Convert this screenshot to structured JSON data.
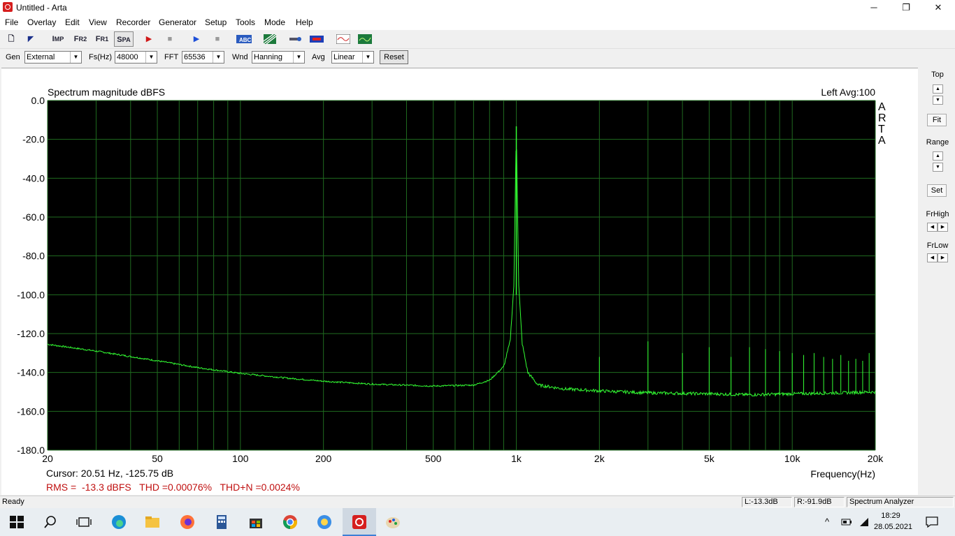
{
  "window": {
    "title": "Untitled - Arta"
  },
  "menu": [
    "File",
    "Overlay",
    "Edit",
    "View",
    "Recorder",
    "Generator",
    "Setup",
    "Tools",
    "Mode",
    "Help"
  ],
  "toolbar": {
    "buttons": [
      {
        "name": "open-icon",
        "glyph": "▯"
      },
      {
        "name": "pointer-icon",
        "glyph": "◤"
      },
      {
        "name": "imp-button",
        "glyph": "IMP"
      },
      {
        "name": "fr2-button",
        "glyph": "FR2"
      },
      {
        "name": "fr1-button",
        "glyph": "FR1"
      },
      {
        "name": "spa-button",
        "glyph": "SPA"
      },
      {
        "name": "record-play-icon",
        "glyph": "▶"
      },
      {
        "name": "record-stop-icon",
        "glyph": "■"
      },
      {
        "name": "play-icon",
        "glyph": "▶"
      },
      {
        "name": "stop-icon",
        "glyph": "■"
      }
    ]
  },
  "params": {
    "gen_label": "Gen",
    "gen_value": "External",
    "fs_label": "Fs(Hz)",
    "fs_value": "48000",
    "fft_label": "FFT",
    "fft_value": "65536",
    "wnd_label": "Wnd",
    "wnd_value": "Hanning",
    "avg_label": "Avg",
    "avg_value": "Linear",
    "reset_label": "Reset"
  },
  "side": {
    "top_label": "Top",
    "fit_label": "Fit",
    "range_label": "Range",
    "set_label": "Set",
    "frhigh_label": "FrHigh",
    "frlow_label": "FrLow"
  },
  "chart_data": {
    "type": "line",
    "title": "Spectrum magnitude dBFS",
    "channel_info": "Left  Avg:100",
    "watermark": "ARTA",
    "xlabel": "Frequency(Hz)",
    "xscale": "log",
    "xlim": [
      20,
      20000
    ],
    "ylim": [
      -180,
      0
    ],
    "x_tick_labels": [
      {
        "v": 20,
        "t": "20"
      },
      {
        "v": 50,
        "t": "50"
      },
      {
        "v": 100,
        "t": "100"
      },
      {
        "v": 200,
        "t": "200"
      },
      {
        "v": 500,
        "t": "500"
      },
      {
        "v": 1000,
        "t": "1k"
      },
      {
        "v": 2000,
        "t": "2k"
      },
      {
        "v": 5000,
        "t": "5k"
      },
      {
        "v": 10000,
        "t": "10k"
      },
      {
        "v": 20000,
        "t": "20k"
      }
    ],
    "y_tick_labels": [
      "0.0",
      "-20.0",
      "-40.0",
      "-60.0",
      "-80.0",
      "-100.0",
      "-120.0",
      "-140.0",
      "-160.0",
      "-180.0"
    ],
    "series": [
      {
        "color": "#33ff33",
        "x": [
          20,
          30,
          50,
          70,
          100,
          150,
          200,
          300,
          500,
          700,
          800,
          900,
          950,
          980,
          1000,
          1020,
          1050,
          1100,
          1200,
          1500,
          2000,
          3000,
          5000,
          7000,
          10000,
          15000,
          20000
        ],
        "y": [
          -125.5,
          -129,
          -134,
          -137.5,
          -140.5,
          -143,
          -144.5,
          -146,
          -147,
          -146.5,
          -144,
          -137,
          -124,
          -95,
          -13.3,
          -95,
          -125,
          -140,
          -146.5,
          -148.5,
          -149.5,
          -150.5,
          -151,
          -151.5,
          -151,
          -150.5,
          -150
        ]
      }
    ],
    "harmonics": [
      {
        "f": 2000,
        "db": -132
      },
      {
        "f": 3000,
        "db": -124
      },
      {
        "f": 4000,
        "db": -130
      },
      {
        "f": 5000,
        "db": -127
      },
      {
        "f": 6000,
        "db": -132
      },
      {
        "f": 7000,
        "db": -127
      },
      {
        "f": 8000,
        "db": -128
      },
      {
        "f": 9000,
        "db": -129
      },
      {
        "f": 10000,
        "db": -130
      },
      {
        "f": 11000,
        "db": -131
      },
      {
        "f": 12000,
        "db": -130
      },
      {
        "f": 13000,
        "db": -132
      },
      {
        "f": 14000,
        "db": -133
      },
      {
        "f": 15000,
        "db": -131
      },
      {
        "f": 16000,
        "db": -134
      },
      {
        "f": 17000,
        "db": -133
      },
      {
        "f": 18000,
        "db": -134
      },
      {
        "f": 19000,
        "db": -130
      }
    ],
    "cursor_text": "Cursor: 20.51 Hz, -125.75 dB",
    "measure_text": "RMS =  -13.3 dBFS   THD =0.00076%   THD+N =0.0024%",
    "grid": true,
    "plot_bg": "#000000",
    "grid_color": "#1f6b1f"
  },
  "status": {
    "ready": "Ready",
    "left_level": "L:-13.3dB",
    "right_level": "R:-91.9dB",
    "mode": "Spectrum Analyzer"
  },
  "taskbar": {
    "time": "18:29",
    "date": "28.05.2021"
  }
}
